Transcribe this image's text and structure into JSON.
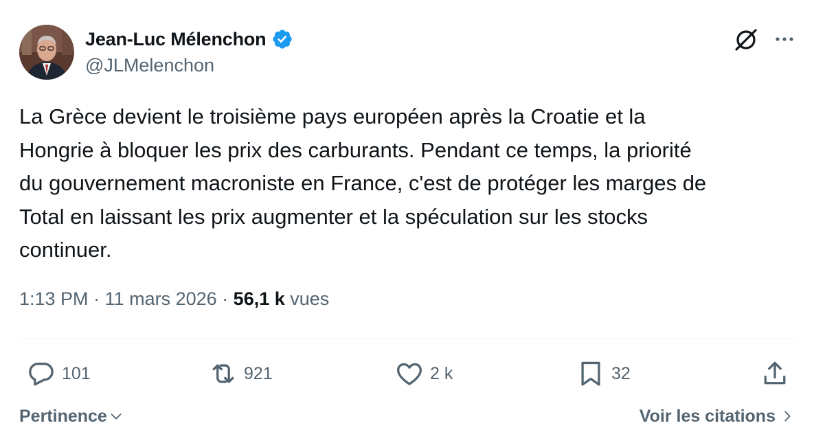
{
  "author": {
    "name": "Jean-Luc Mélenchon",
    "handle": "@JLMelenchon",
    "verified": true,
    "verified_color": "#1d9bf0"
  },
  "header_icons": [
    "grok-icon",
    "more-options-icon"
  ],
  "tweet": {
    "text": "La Grèce devient le troisième pays européen après la Croatie et la\nHongrie à bloquer les prix des carburants. Pendant ce temps, la priorité\ndu gouvernement macroniste en France, c'est de protéger les marges de\nTotal en laissant les prix augmenter et la spéculation sur les stocks\ncontinuer."
  },
  "meta": {
    "time": "1:13 PM",
    "separator": " · ",
    "date": "11 mars 2026",
    "views_count": "56,1 k",
    "views_label": " vues"
  },
  "actions": {
    "reply_count": "101",
    "retweet_count": "921",
    "like_count": "2 k",
    "bookmark_count": "32"
  },
  "footer": {
    "sort_label": "Pertinence",
    "quotes_label": "Voir les citations"
  },
  "colors": {
    "text_primary": "#0f1419",
    "text_secondary": "#536471",
    "divider": "#eff3f4"
  }
}
